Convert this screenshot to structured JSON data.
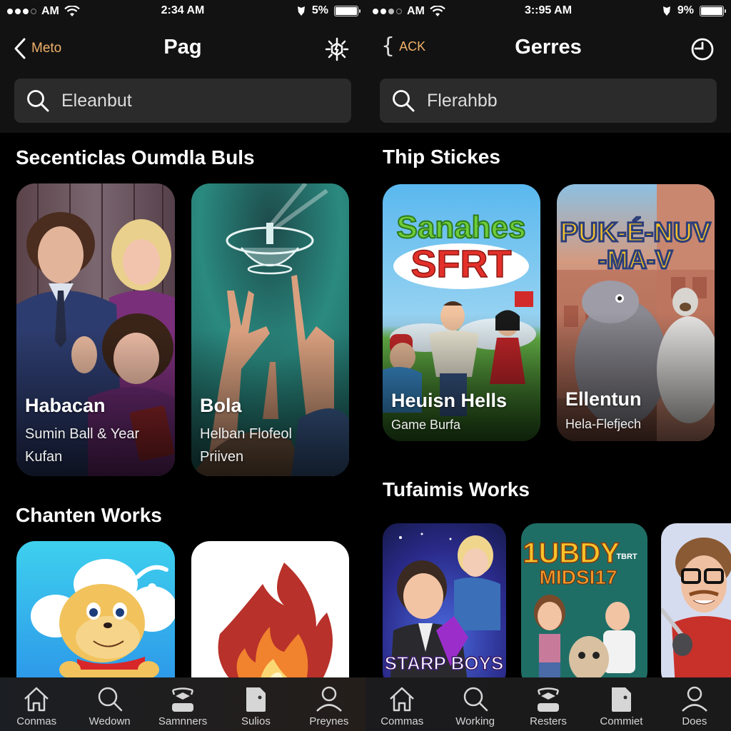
{
  "screens": [
    {
      "status": {
        "carrier": "AM",
        "time": "2:34 AM",
        "battery": "5%",
        "battery_level": 1.0
      },
      "nav": {
        "back_label": "Meto",
        "title": "Pag",
        "action_icon": "settings-sun-icon"
      },
      "search": {
        "value": "Eleanbut",
        "placeholder": "Search"
      },
      "sections": [
        {
          "title": "Secenticlas Oumdla Buls",
          "cards": [
            {
              "title": "Habacan",
              "subtitle": "Sumin Ball & Year",
              "subtitle2": "Kufan",
              "art": "family-portrait"
            },
            {
              "title": "Bola",
              "subtitle": "Helban Flofeol",
              "subtitle2": "Priiven",
              "art": "hands-reaching-glass-ufo"
            }
          ]
        },
        {
          "title": "Chanten Works",
          "cards": [
            {
              "title": "",
              "art": "cartoon-bear-app-icon"
            },
            {
              "title": "",
              "art": "flame-app-icon"
            }
          ]
        }
      ],
      "tabs": [
        {
          "label": "Conmas",
          "icon": "home-icon"
        },
        {
          "label": "Wedown",
          "icon": "search-icon"
        },
        {
          "label": "Samnners",
          "icon": "stack-icon"
        },
        {
          "label": "Sulios",
          "icon": "document-icon"
        },
        {
          "label": "Preynes",
          "icon": "profile-icon"
        }
      ]
    },
    {
      "status": {
        "carrier": "AM",
        "time": "3::95 AM",
        "battery": "9%",
        "battery_level": 1.0
      },
      "nav": {
        "back_label": "ACK",
        "title": "Gerres",
        "action_icon": "clock-icon"
      },
      "search": {
        "value": "Flerahbb",
        "placeholder": "Search"
      },
      "sections": [
        {
          "title": "Thip Stickes",
          "cards": [
            {
              "title": "Heuisn Hells",
              "subtitle": "Game Burfa",
              "art_text_1": "Sanahes",
              "art_text_2": "SFRT",
              "art": "cartoon-family-field"
            },
            {
              "title": "Ellentun",
              "subtitle": "Hela-Flefjech",
              "art_text_1": "PUK-É-NUV",
              "art_text_2": "-MA-V",
              "art": "cartoon-creatures-city"
            }
          ]
        },
        {
          "title": "Tufaimis Works",
          "cards": [
            {
              "title": "",
              "art_text_1": "STARP BOYS",
              "art": "cartoon-businessman-space"
            },
            {
              "title": "",
              "art_text_1": "1UBDY",
              "art_text_2": "MIDSI17",
              "art_text_3": "TBRT",
              "art": "cartoon-kids-teal"
            },
            {
              "title": "",
              "art": "cartoon-man-glasses"
            }
          ]
        }
      ],
      "tabs": [
        {
          "label": "Commas",
          "icon": "home-icon"
        },
        {
          "label": "Working",
          "icon": "search-icon"
        },
        {
          "label": "Resters",
          "icon": "stack-icon"
        },
        {
          "label": "Commiet",
          "icon": "document-icon"
        },
        {
          "label": "Does",
          "icon": "profile-icon"
        }
      ]
    }
  ],
  "colors": {
    "accent": "#f0b169",
    "background": "#000000",
    "header": "#121212",
    "search_bg": "#2b2b2b"
  }
}
